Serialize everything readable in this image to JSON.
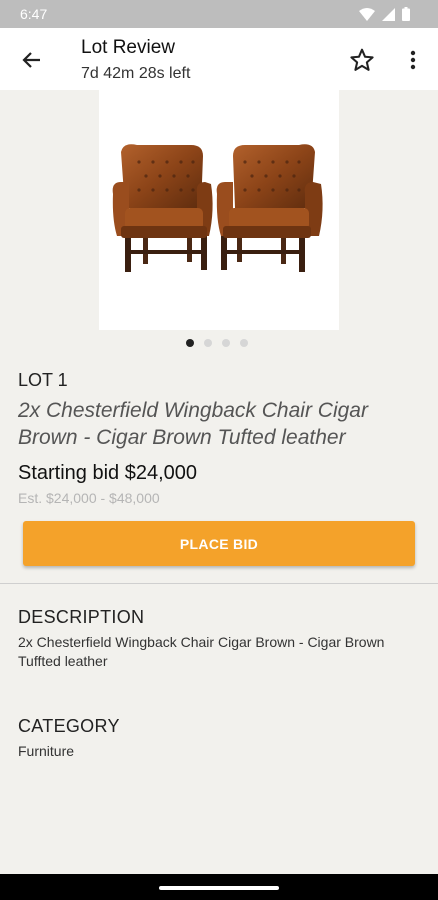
{
  "status_bar": {
    "time": "6:47"
  },
  "app_bar": {
    "back_icon": "arrow-back-icon",
    "title": "Lot Review",
    "subtitle": "7d 42m 28s left",
    "favorite_icon": "star-outline-icon",
    "menu_icon": "more-vert-icon"
  },
  "gallery": {
    "image_subject": "chairs-photo",
    "page_count": 4,
    "current_page": 1
  },
  "lot": {
    "number": "LOT 1",
    "title": "2x Chesterfield Wingback Chair Cigar Brown - Cigar Brown Tufted leather",
    "starting_bid": "Starting bid $24,000",
    "estimate": "Est. $24,000 - $48,000"
  },
  "actions": {
    "place_bid_label": "PLACE BID"
  },
  "description": {
    "heading": "DESCRIPTION",
    "body": "2x Chesterfield Wingback Chair Cigar Brown - Cigar Brown Tuffted leather"
  },
  "category": {
    "heading": "CATEGORY",
    "value": "Furniture"
  },
  "colors": {
    "accent": "#f4a22a",
    "background": "#f2f1ed"
  }
}
